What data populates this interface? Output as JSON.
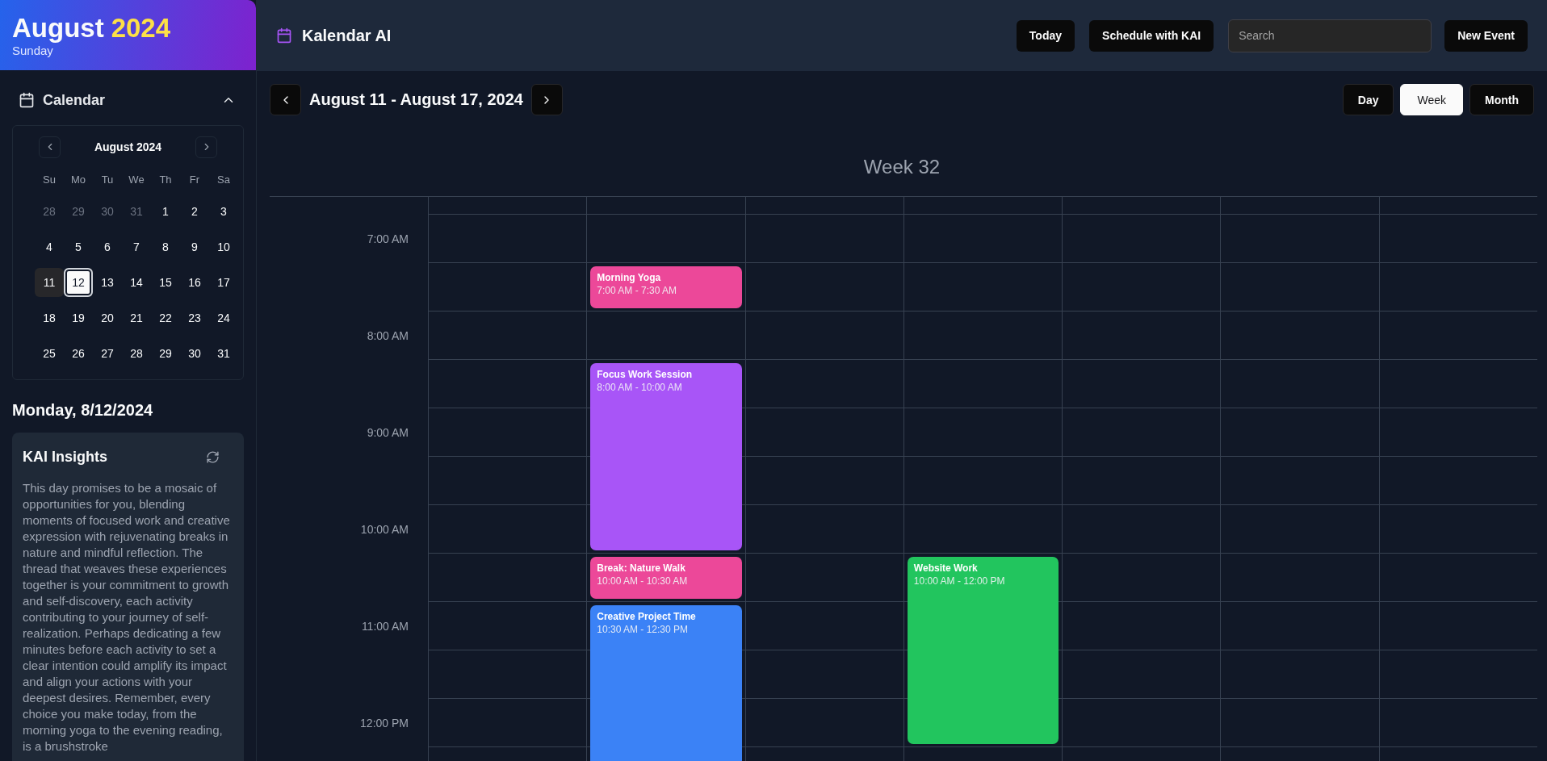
{
  "sidebar": {
    "banner": {
      "month": "August",
      "year": "2024",
      "weekday": "Sunday"
    },
    "calendar_section": {
      "title": "Calendar",
      "expanded": true
    },
    "mini_calendar": {
      "title": "August 2024",
      "weekdays": [
        "Su",
        "Mo",
        "Tu",
        "We",
        "Th",
        "Fr",
        "Sa"
      ],
      "weeks": [
        [
          {
            "day": "28",
            "outside": true,
            "today": false,
            "selected": false
          },
          {
            "day": "29",
            "outside": true,
            "today": false,
            "selected": false
          },
          {
            "day": "30",
            "outside": true,
            "today": false,
            "selected": false
          },
          {
            "day": "31",
            "outside": true,
            "today": false,
            "selected": false
          },
          {
            "day": "1",
            "outside": false,
            "today": false,
            "selected": false
          },
          {
            "day": "2",
            "outside": false,
            "today": false,
            "selected": false
          },
          {
            "day": "3",
            "outside": false,
            "today": false,
            "selected": false
          }
        ],
        [
          {
            "day": "4",
            "outside": false,
            "today": false,
            "selected": false
          },
          {
            "day": "5",
            "outside": false,
            "today": false,
            "selected": false
          },
          {
            "day": "6",
            "outside": false,
            "today": false,
            "selected": false
          },
          {
            "day": "7",
            "outside": false,
            "today": false,
            "selected": false
          },
          {
            "day": "8",
            "outside": false,
            "today": false,
            "selected": false
          },
          {
            "day": "9",
            "outside": false,
            "today": false,
            "selected": false
          },
          {
            "day": "10",
            "outside": false,
            "today": false,
            "selected": false
          }
        ],
        [
          {
            "day": "11",
            "outside": false,
            "today": true,
            "selected": false
          },
          {
            "day": "12",
            "outside": false,
            "today": false,
            "selected": true,
            "events": [
              {
                "title": "Morning Yoga",
                "time": "7:00 AM - 7:30 AM",
                "color": "#ec4899"
              },
              {
                "title": "Focus Work Session",
                "time": "8:00 AM - 10:00 AM",
                "color": "#a855f7"
              },
              {
                "title": "Break: Nature Walk",
                "time": "10:00 AM - 10:30 AM",
                "color": "#ec4899"
              },
              {
                "title": "Creative Project Time",
                "time": "10:30 AM - 12:30 PM",
                "color": "#3b82f6"
              }
            ]
          },
          {
            "day": "13",
            "outside": false,
            "today": false,
            "selected": false
          },
          {
            "day": "14",
            "outside": false,
            "today": false,
            "selected": false,
            "events": [
              {
                "title": "Website Work",
                "time": "10:00 AM - 12:00 PM",
                "color": "#22c55e"
              }
            ]
          },
          {
            "day": "15",
            "outside": false,
            "today": false,
            "selected": false
          },
          {
            "day": "16",
            "outside": false,
            "today": false,
            "selected": false
          },
          {
            "day": "17",
            "outside": false,
            "today": false,
            "selected": false
          }
        ],
        [
          {
            "day": "18",
            "outside": false,
            "today": false,
            "selected": false
          },
          {
            "day": "19",
            "outside": false,
            "today": false,
            "selected": false
          },
          {
            "day": "20",
            "outside": false,
            "today": false,
            "selected": false
          },
          {
            "day": "21",
            "outside": false,
            "today": false,
            "selected": false
          },
          {
            "day": "22",
            "outside": false,
            "today": false,
            "selected": false
          },
          {
            "day": "23",
            "outside": false,
            "today": false,
            "selected": false
          },
          {
            "day": "24",
            "outside": false,
            "today": false,
            "selected": false
          }
        ],
        [
          {
            "day": "25",
            "outside": false,
            "today": false,
            "selected": false
          },
          {
            "day": "26",
            "outside": false,
            "today": false,
            "selected": false
          },
          {
            "day": "27",
            "outside": false,
            "today": false,
            "selected": false
          },
          {
            "day": "28",
            "outside": false,
            "today": false,
            "selected": false
          },
          {
            "day": "29",
            "outside": false,
            "today": false,
            "selected": false
          },
          {
            "day": "30",
            "outside": false,
            "today": false,
            "selected": false
          },
          {
            "day": "31",
            "outside": false,
            "today": false,
            "selected": false
          }
        ]
      ]
    },
    "selected_date": "Monday, 8/12/2024",
    "insights": {
      "title": "KAI Insights",
      "text": "This day promises to be a mosaic of opportunities for you, blending moments of focused work and creative expression with rejuvenating breaks in nature and mindful reflection. The thread that weaves these experiences together is your commitment to growth and self-discovery, each activity contributing to your journey of self-realization. Perhaps dedicating a few minutes before each activity to set a clear intention could amplify its impact and align your actions with your deepest desires. Remember, every choice you make today, from the morning yoga to the evening reading, is a brushstroke"
    }
  },
  "header": {
    "app_name": "Kalendar AI",
    "buttons": [
      "Today",
      "Schedule with KAI"
    ],
    "search": {
      "placeholder": "Search"
    },
    "new_event": "New Event"
  },
  "toolbar": {
    "range": "August 11 - August 17, 2024",
    "views": [
      {
        "label": "Day",
        "selected": false
      },
      {
        "label": "Week",
        "selected": true
      },
      {
        "label": "Month",
        "selected": false
      }
    ]
  },
  "week": {
    "title": "Week 32",
    "hours": [
      "7:00 AM",
      "8:00 AM",
      "9:00 AM",
      "10:00 AM",
      "11:00 AM",
      "12:00 PM"
    ]
  }
}
